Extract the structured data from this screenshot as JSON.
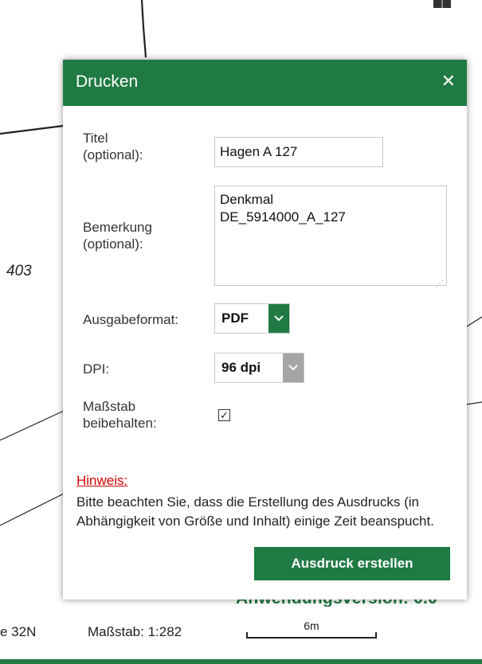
{
  "map": {
    "label": "403"
  },
  "dialog": {
    "title": "Drucken",
    "close_icon": "close-icon",
    "fields": {
      "title_label_1": "Titel",
      "title_label_2": "(optional):",
      "title_value": "Hagen A 127",
      "remark_label_1": "Bemerkung",
      "remark_label_2": "(optional):",
      "remark_value": "Denkmal\nDE_5914000_A_127",
      "format_label": "Ausgabeformat:",
      "format_value": "PDF",
      "dpi_label": "DPI:",
      "dpi_value": "96 dpi",
      "keep_scale_label_1": "Maßstab",
      "keep_scale_label_2": "beibehalten:",
      "keep_scale_checked": true
    },
    "hint": {
      "title": "Hinweis:",
      "text": "Bitte beachten Sie, dass die Erstellung des Ausdrucks (in Abhängigkeit von Größe und Inhalt) einige Zeit beanspucht."
    },
    "submit_label": "Ausdruck erstellen"
  },
  "footer": {
    "version_text": "Anwendungsversion: 0.0",
    "projection_text": "e 32N",
    "scale_text": "Maßstab: 1:282",
    "scale_bar_label": "6m"
  },
  "colors": {
    "brand": "#1f7a43",
    "hint": "#d40000",
    "disabled_arrow": "#a5a5a5"
  }
}
